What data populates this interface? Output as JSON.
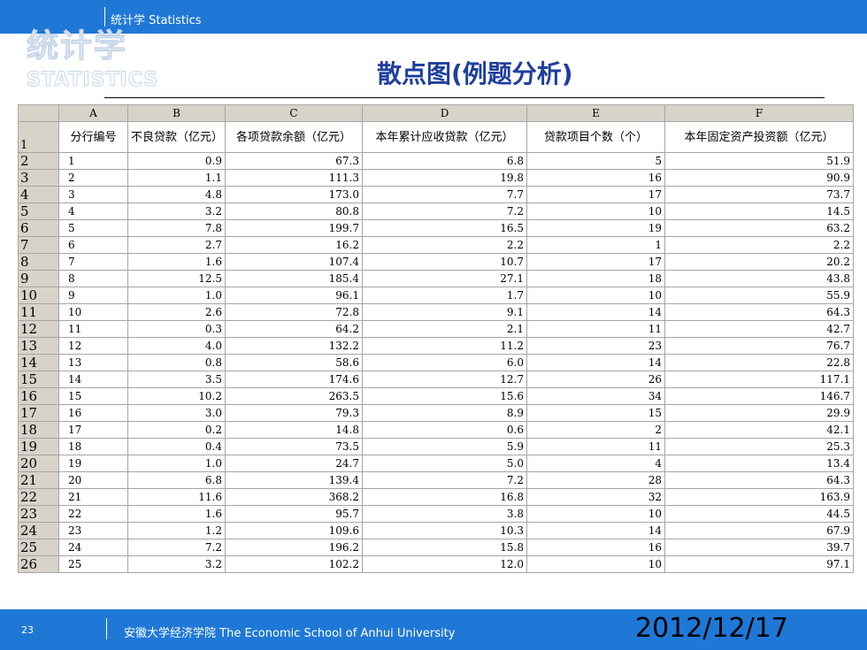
{
  "header": {
    "text": "统计学  Statistics"
  },
  "logo": {
    "cn": "统计学",
    "en": "STATISTICS"
  },
  "title": "散点图(例题分析)",
  "sheet": {
    "col_letters": [
      "A",
      "B",
      "C",
      "D",
      "E",
      "F"
    ],
    "header_row_num": "1",
    "headers": [
      "分行编号",
      "不良贷款（亿元）",
      "各项贷款余额（亿元）",
      "本年累计应收贷款（亿元）",
      "贷款项目个数（个）",
      "本年固定资产投资额（亿元）"
    ],
    "rows": [
      [
        "2",
        "1",
        "0.9",
        "67.3",
        "6.8",
        "5",
        "51.9"
      ],
      [
        "3",
        "2",
        "1.1",
        "111.3",
        "19.8",
        "16",
        "90.9"
      ],
      [
        "4",
        "3",
        "4.8",
        "173.0",
        "7.7",
        "17",
        "73.7"
      ],
      [
        "5",
        "4",
        "3.2",
        "80.8",
        "7.2",
        "10",
        "14.5"
      ],
      [
        "6",
        "5",
        "7.8",
        "199.7",
        "16.5",
        "19",
        "63.2"
      ],
      [
        "7",
        "6",
        "2.7",
        "16.2",
        "2.2",
        "1",
        "2.2"
      ],
      [
        "8",
        "7",
        "1.6",
        "107.4",
        "10.7",
        "17",
        "20.2"
      ],
      [
        "9",
        "8",
        "12.5",
        "185.4",
        "27.1",
        "18",
        "43.8"
      ],
      [
        "10",
        "9",
        "1.0",
        "96.1",
        "1.7",
        "10",
        "55.9"
      ],
      [
        "11",
        "10",
        "2.6",
        "72.8",
        "9.1",
        "14",
        "64.3"
      ],
      [
        "12",
        "11",
        "0.3",
        "64.2",
        "2.1",
        "11",
        "42.7"
      ],
      [
        "13",
        "12",
        "4.0",
        "132.2",
        "11.2",
        "23",
        "76.7"
      ],
      [
        "14",
        "13",
        "0.8",
        "58.6",
        "6.0",
        "14",
        "22.8"
      ],
      [
        "15",
        "14",
        "3.5",
        "174.6",
        "12.7",
        "26",
        "117.1"
      ],
      [
        "16",
        "15",
        "10.2",
        "263.5",
        "15.6",
        "34",
        "146.7"
      ],
      [
        "17",
        "16",
        "3.0",
        "79.3",
        "8.9",
        "15",
        "29.9"
      ],
      [
        "18",
        "17",
        "0.2",
        "14.8",
        "0.6",
        "2",
        "42.1"
      ],
      [
        "19",
        "18",
        "0.4",
        "73.5",
        "5.9",
        "11",
        "25.3"
      ],
      [
        "20",
        "19",
        "1.0",
        "24.7",
        "5.0",
        "4",
        "13.4"
      ],
      [
        "21",
        "20",
        "6.8",
        "139.4",
        "7.2",
        "28",
        "64.3"
      ],
      [
        "22",
        "21",
        "11.6",
        "368.2",
        "16.8",
        "32",
        "163.9"
      ],
      [
        "23",
        "22",
        "1.6",
        "95.7",
        "3.8",
        "10",
        "44.5"
      ],
      [
        "24",
        "23",
        "1.2",
        "109.6",
        "10.3",
        "14",
        "67.9"
      ],
      [
        "25",
        "24",
        "7.2",
        "196.2",
        "15.8",
        "16",
        "39.7"
      ],
      [
        "26",
        "25",
        "3.2",
        "102.2",
        "12.0",
        "10",
        "97.1"
      ]
    ]
  },
  "footer": {
    "page": "23",
    "text": "安徽大学经济学院 The Economic School of Anhui University",
    "date": "2012/12/17"
  }
}
